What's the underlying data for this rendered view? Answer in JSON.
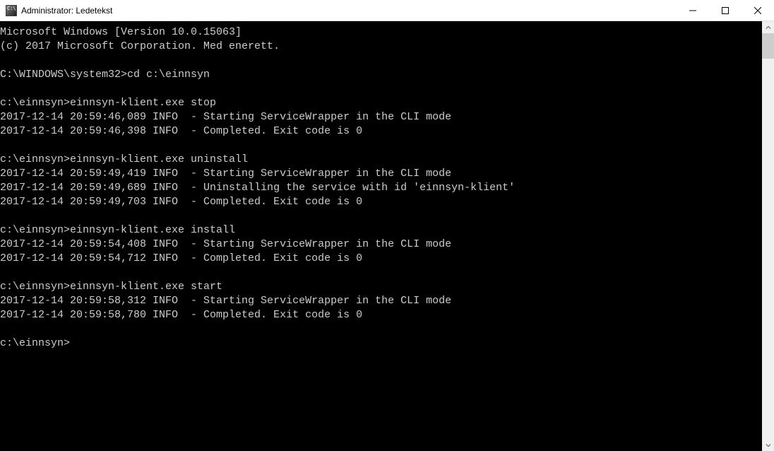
{
  "window": {
    "title": "Administrator: Ledetekst"
  },
  "terminal": {
    "lines": [
      "Microsoft Windows [Version 10.0.15063]",
      "(c) 2017 Microsoft Corporation. Med enerett.",
      "",
      "C:\\WINDOWS\\system32>cd c:\\einnsyn",
      "",
      "c:\\einnsyn>einnsyn-klient.exe stop",
      "2017-12-14 20:59:46,089 INFO  - Starting ServiceWrapper in the CLI mode",
      "2017-12-14 20:59:46,398 INFO  - Completed. Exit code is 0",
      "",
      "c:\\einnsyn>einnsyn-klient.exe uninstall",
      "2017-12-14 20:59:49,419 INFO  - Starting ServiceWrapper in the CLI mode",
      "2017-12-14 20:59:49,689 INFO  - Uninstalling the service with id 'einnsyn-klient'",
      "2017-12-14 20:59:49,703 INFO  - Completed. Exit code is 0",
      "",
      "c:\\einnsyn>einnsyn-klient.exe install",
      "2017-12-14 20:59:54,408 INFO  - Starting ServiceWrapper in the CLI mode",
      "2017-12-14 20:59:54,712 INFO  - Completed. Exit code is 0",
      "",
      "c:\\einnsyn>einnsyn-klient.exe start",
      "2017-12-14 20:59:58,312 INFO  - Starting ServiceWrapper in the CLI mode",
      "2017-12-14 20:59:58,780 INFO  - Completed. Exit code is 0",
      "",
      "c:\\einnsyn>"
    ]
  }
}
